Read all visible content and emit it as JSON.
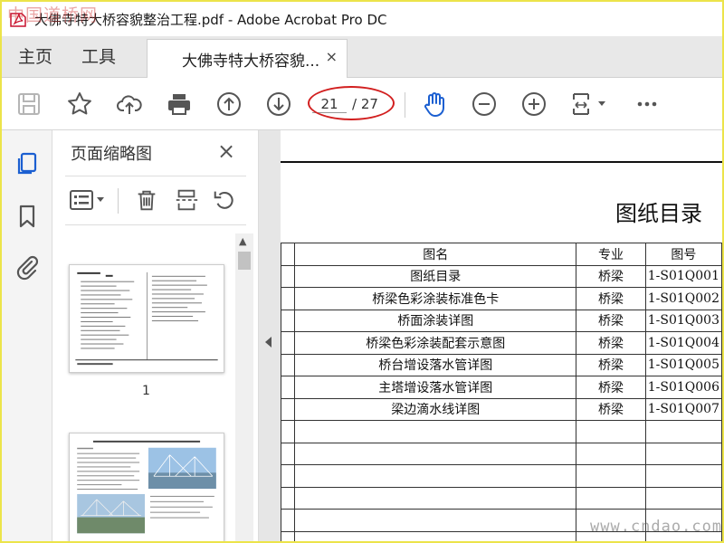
{
  "window": {
    "title": "大佛寺特大桥容貌整治工程.pdf - Adobe Acrobat Pro DC",
    "watermark_top_left": "中国道桥网",
    "watermark_bottom_right": "www.cndao.com"
  },
  "tabs": {
    "home": "主页",
    "tools": "工具",
    "document": "大佛寺特大桥容貌...",
    "close": "×"
  },
  "toolbar": {
    "icons": [
      "save-icon",
      "star-icon",
      "cloud-upload-icon",
      "print-icon",
      "page-up-icon",
      "page-down-icon",
      "hand-icon",
      "zoom-out-icon",
      "zoom-in-icon",
      "fit-page-icon",
      "more-icon"
    ],
    "current_page": "21",
    "total_pages": "/ 27",
    "highlight_color": "#d21f1f",
    "accent_color": "#1b5fd1"
  },
  "panel": {
    "title": "页面缩略图",
    "close": "×",
    "thumbnail_1_label": "1"
  },
  "document": {
    "heading": "图纸目录",
    "headers": [
      "图名",
      "专业",
      "图号"
    ],
    "rows": [
      [
        "图纸目录",
        "桥梁",
        "1-S01Q001"
      ],
      [
        "桥梁色彩涂装标准色卡",
        "桥梁",
        "1-S01Q002"
      ],
      [
        "桥面涂装详图",
        "桥梁",
        "1-S01Q003"
      ],
      [
        "桥梁色彩涂装配套示意图",
        "桥梁",
        "1-S01Q004"
      ],
      [
        "桥台增设落水管详图",
        "桥梁",
        "1-S01Q005"
      ],
      [
        "主塔增设落水管详图",
        "桥梁",
        "1-S01Q006"
      ],
      [
        "梁边滴水线详图",
        "桥梁",
        "1-S01Q007"
      ]
    ]
  }
}
